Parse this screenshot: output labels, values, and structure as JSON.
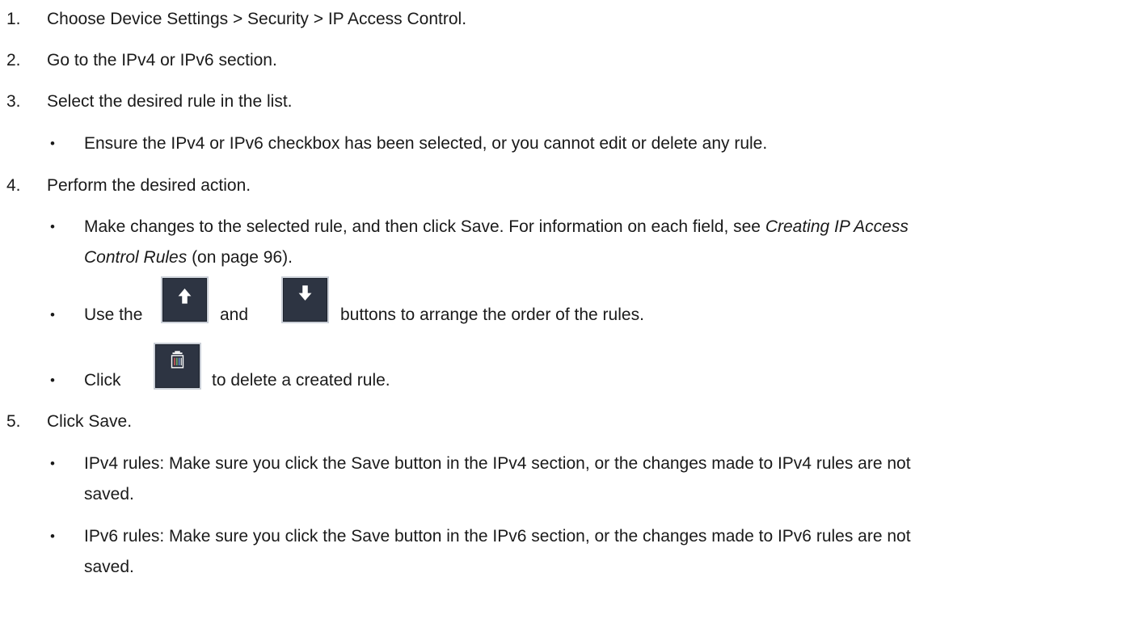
{
  "steps": [
    {
      "num": "1.",
      "text": "Choose Device Settings > Security > IP Access Control."
    },
    {
      "num": "2.",
      "text": "Go to the IPv4 or IPv6 section."
    },
    {
      "num": "3.",
      "text": "Select the desired rule in the list."
    },
    {
      "num": "4.",
      "text": "Perform the desired action."
    },
    {
      "num": "5.",
      "text": "Click Save."
    }
  ],
  "bullet_char": "•",
  "step3_note": "Ensure the IPv4 or IPv6 checkbox has been selected, or you cannot edit or delete any rule.",
  "step4": {
    "edit_pre": "Make changes to the selected rule, and then click Save. For information on each field, see ",
    "link_line1": "Creating IP Access",
    "link_line2": "Control Rules",
    "page_ref": " (on page 96).",
    "arrange_pre": "Use the",
    "arrange_mid": "and",
    "arrange_post": "buttons to arrange the order of the rules.",
    "up_icon": "arrow-up-icon",
    "down_icon": "arrow-down-icon",
    "delete_pre": "Click",
    "delete_post": "to delete a created rule.",
    "delete_icon": "trash-icon"
  },
  "step5": {
    "ipv4_line1": "IPv4 rules: Make sure you click the Save button in the IPv4 section, or the changes made to IPv4 rules are not",
    "ipv4_line2": "saved.",
    "ipv6_line1": "IPv6 rules: Make sure you click the Save button in the IPv6 section, or the changes made to IPv6 rules are not",
    "ipv6_line2": "saved."
  }
}
